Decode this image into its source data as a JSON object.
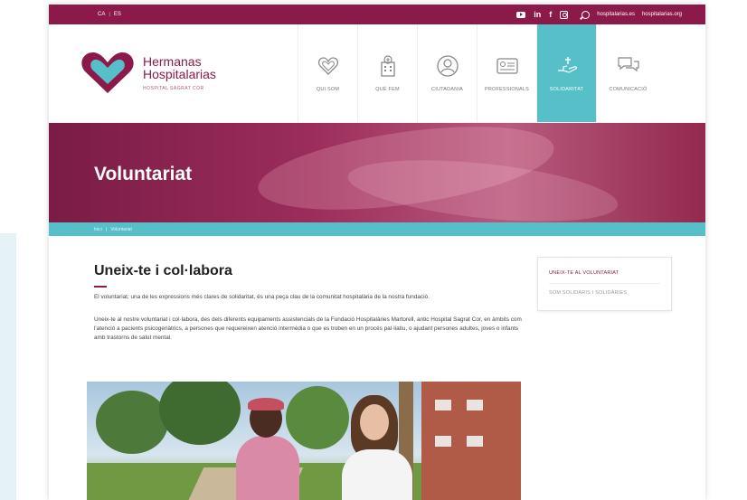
{
  "topbar": {
    "langs": [
      "CA",
      "ES"
    ],
    "social_icons": [
      "youtube-icon",
      "linkedin-icon",
      "facebook-icon",
      "instagram-icon"
    ],
    "linkedin": "in",
    "facebook": "f",
    "links": [
      "hospitalarias.es",
      "hospitalarias.org"
    ]
  },
  "logo": {
    "title_line1": "Hermanas",
    "title_line2": "Hospitalarias",
    "subtitle": "HOSPITAL SAGRAT COR",
    "heart_color": "#8b1a4a",
    "heart_accent": "#56bfc8"
  },
  "nav": [
    {
      "label": "QUI SOM",
      "icon": "heart-icon"
    },
    {
      "label": "QUÈ FEM",
      "icon": "hospital-icon"
    },
    {
      "label": "CIUTADANIA",
      "icon": "person-icon"
    },
    {
      "label": "PROFESSIONALS",
      "icon": "id-card-icon"
    },
    {
      "label": "SOLIDARITAT",
      "icon": "giving-hand-icon",
      "active": true
    },
    {
      "label": "COMUNICACIÓ",
      "icon": "chat-icon"
    }
  ],
  "hero": {
    "title": "Voluntariat"
  },
  "breadcrumb": {
    "home": "Inici",
    "current": "Voluntariat"
  },
  "main": {
    "heading": "Uneix-te i col·labora",
    "p1": "El voluntariat, una de les expressions més clares de solidaritat, és una peça clau de la comunitat hospitalària de la nostra fundació.",
    "p2": "Uneix-te al nostre voluntariat i col·labora, des dels diferents equipaments assistencials de la Fundació Hospitalàries Martorell, antic Hospital Sagrat Cor, en àmbits com l'atenció a pacients psicogeriàtrics, a persones que requereixen atenció intermèdia o que es troben en un procés pal·liatiu, o ajudant persones adultes, joves o infants amb trastorns de salut mental."
  },
  "sidebar": {
    "items": [
      {
        "label": "UNEIX-TE AL VOLUNTARIAT",
        "active": true
      },
      {
        "label": "SOM SOLIDARIS I SOLIDÀRIES",
        "active": false
      }
    ]
  },
  "colors": {
    "brand": "#8b1a4a",
    "accent": "#56bfc8"
  }
}
